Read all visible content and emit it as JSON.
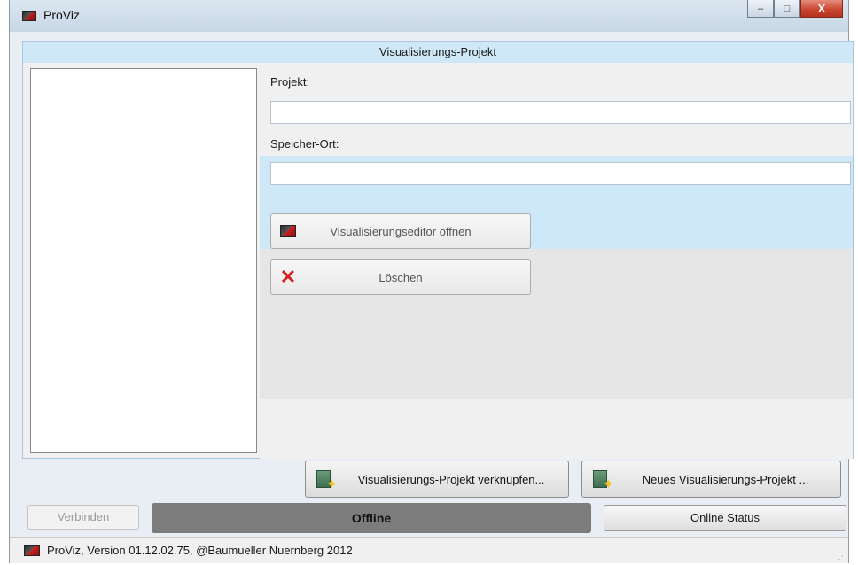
{
  "window": {
    "title": "ProViz",
    "app_icon": "proviz-app-icon",
    "caption_buttons": {
      "minimize": "–",
      "maximize": "□",
      "close": "X"
    }
  },
  "panel": {
    "header": "Visualisierungs-Projekt",
    "projekt_label": "Projekt:",
    "projekt_value": "",
    "speicherort_label": "Speicher-Ort:",
    "speicherort_value": "",
    "editor_button_label": "Visualisierungseditor öffnen",
    "delete_button_label": "Löschen"
  },
  "actions": {
    "link_project_label": "Visualisierungs-Projekt verknüpfen...",
    "new_project_label": "Neues Visualisierungs-Projekt ..."
  },
  "status": {
    "connect_label": "Verbinden",
    "state": "Offline",
    "online_status_label": "Online Status"
  },
  "statusbar": {
    "text": "ProViz, Version 01.12.02.75, @Baumueller Nuernberg 2012"
  },
  "colors": {
    "header_bg": "#cfe8f7",
    "selection_bg": "#cfe8f7",
    "offline_bg": "#7c7c7c",
    "close_red": "#c8432d"
  }
}
